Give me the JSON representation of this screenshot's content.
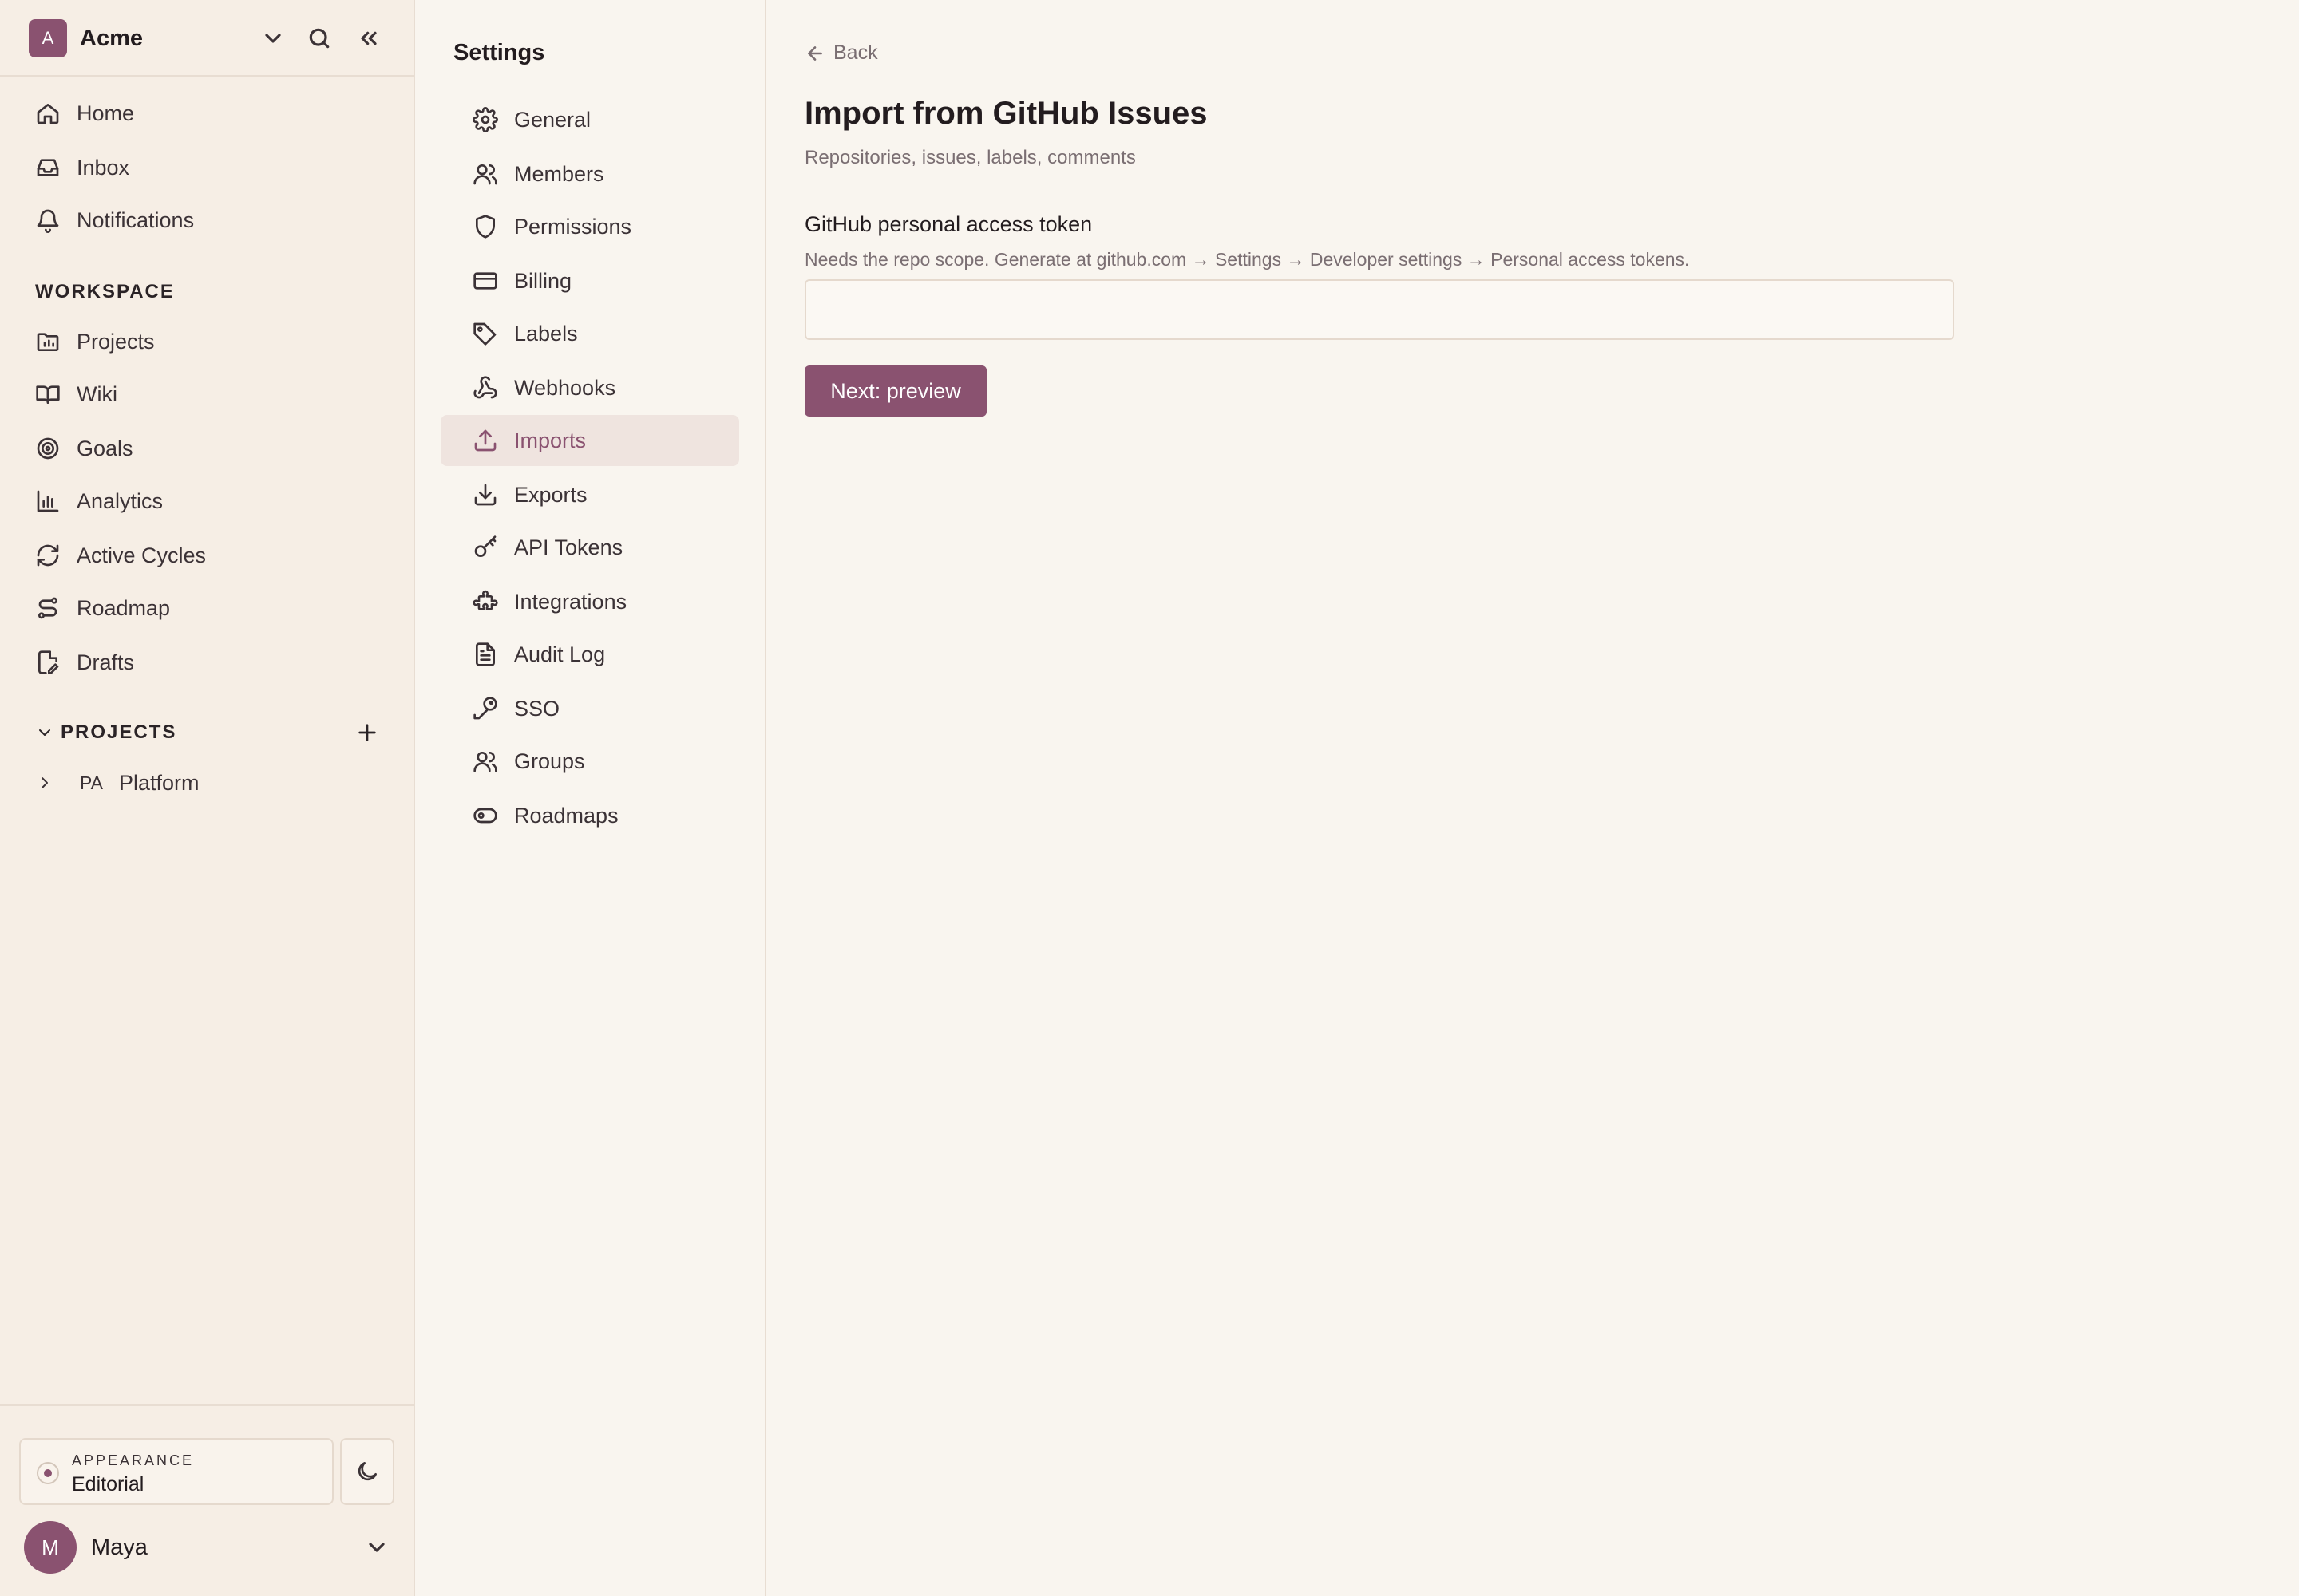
{
  "workspace": {
    "initial": "A",
    "name": "Acme"
  },
  "sidebar": {
    "nav": [
      {
        "label": "Home",
        "icon": "home-icon"
      },
      {
        "label": "Inbox",
        "icon": "inbox-icon"
      },
      {
        "label": "Notifications",
        "icon": "bell-icon"
      }
    ],
    "workspace_title": "WORKSPACE",
    "workspace_items": [
      {
        "label": "Projects",
        "icon": "folder-chart-icon"
      },
      {
        "label": "Wiki",
        "icon": "book-icon"
      },
      {
        "label": "Goals",
        "icon": "target-icon"
      },
      {
        "label": "Analytics",
        "icon": "bar-chart-icon"
      },
      {
        "label": "Active Cycles",
        "icon": "refresh-icon"
      },
      {
        "label": "Roadmap",
        "icon": "route-icon"
      },
      {
        "label": "Drafts",
        "icon": "file-edit-icon"
      }
    ],
    "projects_title": "PROJECTS",
    "projects": [
      {
        "abbr": "PA",
        "name": "Platform"
      }
    ],
    "appearance": {
      "caption": "APPEARANCE",
      "value": "Editorial"
    },
    "user": {
      "initial": "M",
      "name": "Maya"
    }
  },
  "settings": {
    "title": "Settings",
    "items": [
      {
        "label": "General",
        "icon": "gear-icon"
      },
      {
        "label": "Members",
        "icon": "user-icon"
      },
      {
        "label": "Permissions",
        "icon": "shield-icon"
      },
      {
        "label": "Billing",
        "icon": "credit-card-icon"
      },
      {
        "label": "Labels",
        "icon": "tag-icon"
      },
      {
        "label": "Webhooks",
        "icon": "webhook-icon"
      },
      {
        "label": "Imports",
        "icon": "upload-icon",
        "active": true
      },
      {
        "label": "Exports",
        "icon": "download-icon"
      },
      {
        "label": "API Tokens",
        "icon": "key-icon"
      },
      {
        "label": "Integrations",
        "icon": "puzzle-icon"
      },
      {
        "label": "Audit Log",
        "icon": "document-icon"
      },
      {
        "label": "SSO",
        "icon": "key-round-icon"
      },
      {
        "label": "Groups",
        "icon": "users-icon"
      },
      {
        "label": "Roadmaps",
        "icon": "toggle-icon"
      }
    ]
  },
  "main": {
    "back_label": "Back",
    "title": "Import from GitHub Issues",
    "subtitle": "Repositories, issues, labels, comments",
    "field_label": "GitHub personal access token",
    "field_help": "Needs the repo scope. Generate at github.com → Settings → Developer settings → Personal access tokens.",
    "field_value": "",
    "field_placeholder": "",
    "next_button": "Next: preview"
  },
  "colors": {
    "accent": "#8a5270",
    "sidebar_bg": "#f6eee5",
    "page_bg": "#f9f5ef"
  }
}
